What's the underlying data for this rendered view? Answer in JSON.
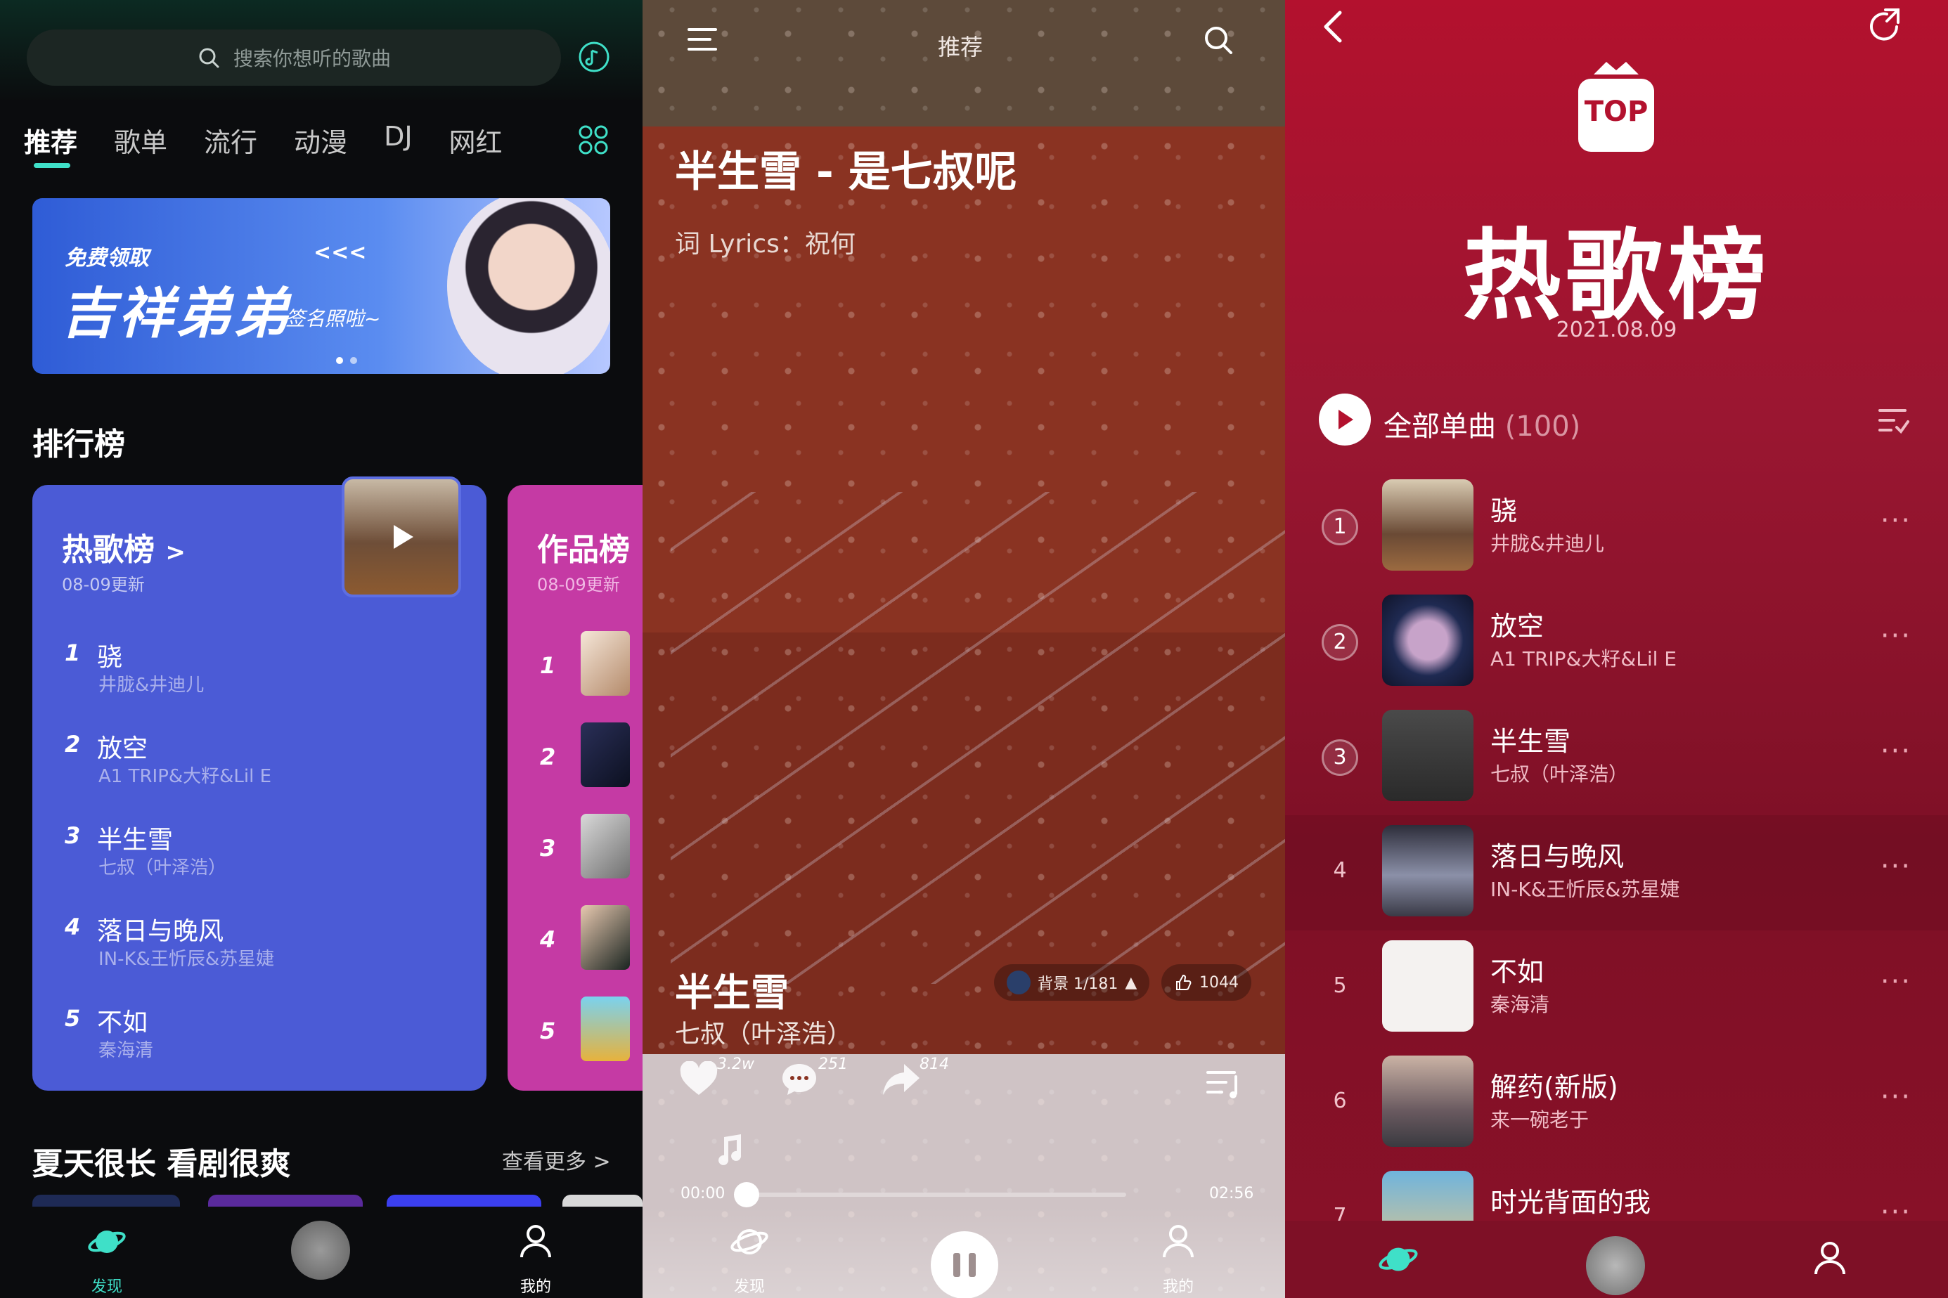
{
  "discover": {
    "search_placeholder": "搜索你想听的歌曲",
    "tabs": [
      "推荐",
      "歌单",
      "流行",
      "动漫",
      "DJ",
      "网红"
    ],
    "banner": {
      "small": "免费领取",
      "big": "吉祥弟弟",
      "sign": "签名照啦~",
      "arrows": "<<<"
    },
    "rankings_title": "排行榜",
    "card1": {
      "title": "热歌榜",
      "chevron": ">",
      "updated": "08-09更新",
      "songs": [
        {
          "num": "1",
          "name": "骁",
          "artist": "井胧&井迪儿"
        },
        {
          "num": "2",
          "name": "放空",
          "artist": "A1 TRIP&大籽&Lil E"
        },
        {
          "num": "3",
          "name": "半生雪",
          "artist": "七叔（叶泽浩）"
        },
        {
          "num": "4",
          "name": "落日与晚风",
          "artist": "IN-K&王忻辰&苏星婕"
        },
        {
          "num": "5",
          "name": "不如",
          "artist": "秦海清"
        }
      ]
    },
    "card2": {
      "title": "作品榜",
      "updated": "08-09更新",
      "nums": [
        "1",
        "2",
        "3",
        "4",
        "5"
      ]
    },
    "summer_title": "夏天很长 看剧很爽",
    "see_more": "查看更多 >",
    "nav": {
      "discover": "发现",
      "mine": "我的"
    }
  },
  "player": {
    "header_label": "推荐",
    "title": "半生雪 - 是七叔呢",
    "lyrics_credit": "词 Lyrics：祝何",
    "song": "半生雪",
    "artist": "七叔（叶泽浩）",
    "bg_pill": "背景 1/181",
    "like_pill": "1044",
    "likes": "3.2w",
    "comments": "251",
    "shares": "814",
    "time_current": "00:00",
    "time_total": "02:56",
    "progress": 0.0,
    "nav": {
      "discover": "发现",
      "mine": "我的"
    }
  },
  "chart": {
    "badge": "TOP",
    "title": "热歌榜",
    "date": "2021.08.09",
    "all_label": "全部单曲",
    "all_count": "(100)",
    "more": "···",
    "rows": [
      {
        "num": "1",
        "name": "骁",
        "artist": "井胧&井迪儿"
      },
      {
        "num": "2",
        "name": "放空",
        "artist": "A1 TRIP&大籽&Lil E"
      },
      {
        "num": "3",
        "name": "半生雪",
        "artist": "七叔（叶泽浩）"
      },
      {
        "num": "4",
        "name": "落日与晚风",
        "artist": "IN-K&王忻辰&苏星婕"
      },
      {
        "num": "5",
        "name": "不如",
        "artist": "秦海清"
      },
      {
        "num": "6",
        "name": "解药(新版)",
        "artist": "来一碗老于"
      },
      {
        "num": "7",
        "name": "时光背面的我",
        "artist": ""
      }
    ]
  },
  "colors": {
    "accent": "#3fe0c8",
    "card_blue": "#4b5bd6",
    "card_pink": "#c53aa4",
    "chart_red": "#9e1430"
  }
}
